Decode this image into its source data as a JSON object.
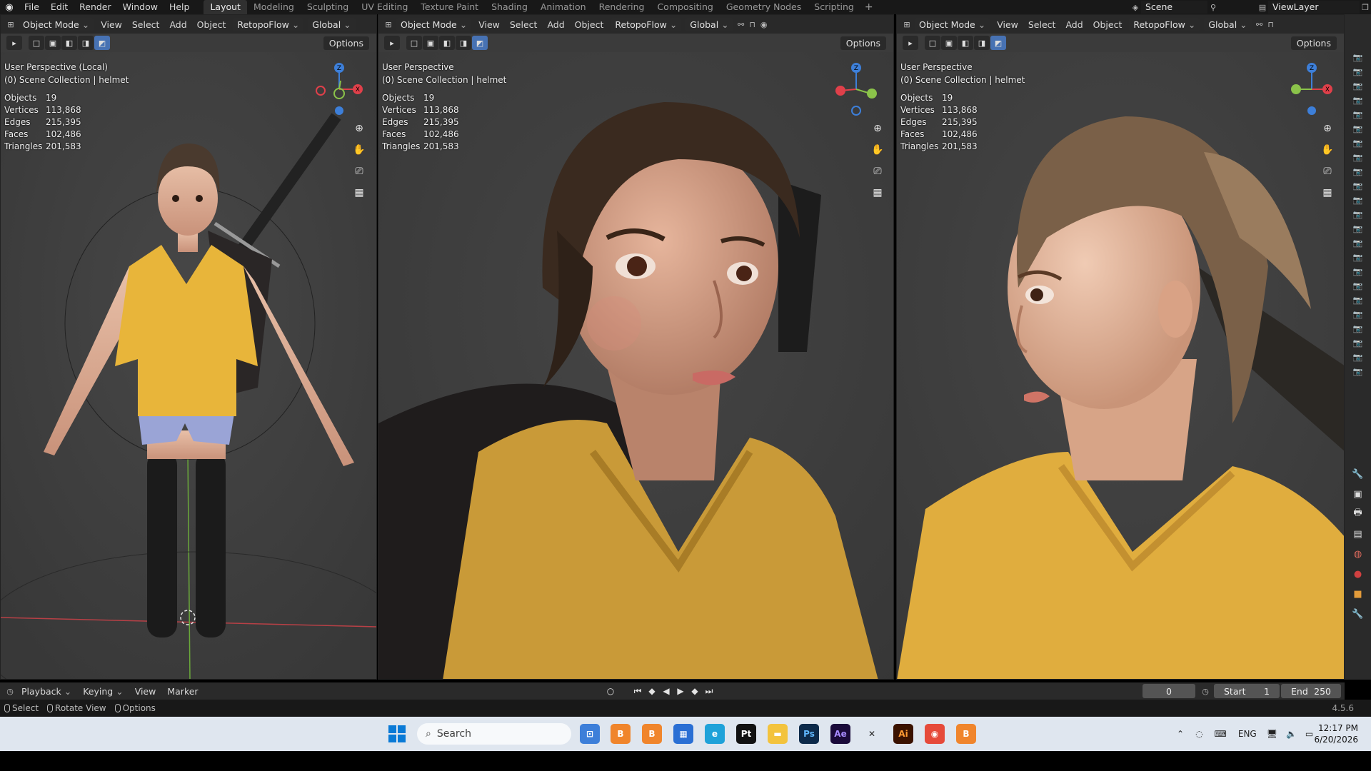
{
  "menu": [
    "File",
    "Edit",
    "Render",
    "Window",
    "Help"
  ],
  "workspaces": [
    "Layout",
    "Modeling",
    "Sculpting",
    "UV Editing",
    "Texture Paint",
    "Shading",
    "Animation",
    "Rendering",
    "Compositing",
    "Geometry Nodes",
    "Scripting"
  ],
  "active_workspace": "Layout",
  "scene": "Scene",
  "view_layer": "ViewLayer",
  "viewport_header": {
    "mode": "Object Mode",
    "view": "View",
    "select": "Select",
    "add": "Add",
    "object": "Object",
    "addon": "RetopoFlow",
    "orientation": "Global",
    "options": "Options"
  },
  "viewports": [
    {
      "perspective": "User Perspective (Local)",
      "collection": "(0) Scene Collection | helmet"
    },
    {
      "perspective": "User Perspective",
      "collection": "(0) Scene Collection | helmet"
    },
    {
      "perspective": "User Perspective",
      "collection": "(0) Scene Collection | helmet"
    }
  ],
  "stats": {
    "objects_label": "Objects",
    "objects": "19",
    "vertices_label": "Vertices",
    "vertices": "113,868",
    "edges_label": "Edges",
    "edges": "215,395",
    "faces_label": "Faces",
    "faces": "102,486",
    "triangles_label": "Triangles",
    "triangles": "201,583"
  },
  "timeline": {
    "playback": "Playback",
    "keying": "Keying",
    "view": "View",
    "marker": "Marker",
    "current_frame": "0",
    "start_label": "Start",
    "start": "1",
    "end_label": "End",
    "end": "250"
  },
  "status": {
    "select": "Select",
    "rotate": "Rotate View",
    "options": "Options",
    "version": "4.5.6"
  },
  "taskbar": {
    "search_placeholder": "Search",
    "language": "ENG",
    "time": "12:17 PM",
    "date": "6/20/2026",
    "apps": [
      "blender-icon",
      "blender-icon",
      "store-icon",
      "edge-icon",
      "pycharm-icon",
      "folder-icon",
      "photoshop-icon",
      "after-effects-icon",
      "zbrush-icon",
      "illustrator-icon",
      "chrome-icon",
      "blender-icon"
    ]
  },
  "colors": {
    "viewport_bg": "#3b3b3b",
    "header_bg": "#282828",
    "accent": "#4772b3",
    "axis_x": "#e0404a",
    "axis_y": "#8bc34a",
    "axis_z": "#3d7fd9"
  }
}
